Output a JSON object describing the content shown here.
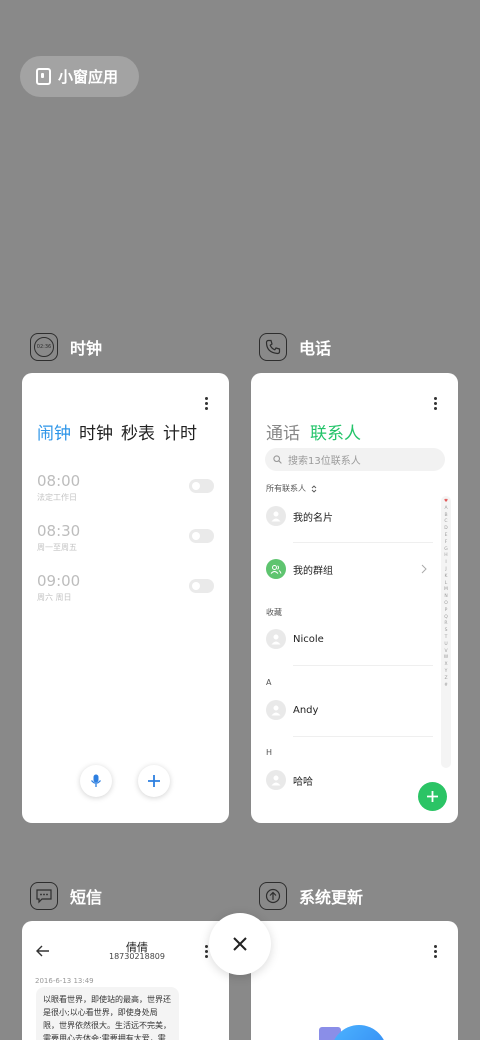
{
  "floating_window": {
    "label": "小窗应用"
  },
  "apps": {
    "clock": {
      "name": "时钟",
      "icon_time": "02:36",
      "tabs": [
        "闹钟",
        "时钟",
        "秒表",
        "计时"
      ],
      "active_tab": "闹钟",
      "alarms": [
        {
          "time": "08:00",
          "repeat": "法定工作日",
          "enabled": false
        },
        {
          "time": "08:30",
          "repeat": "周一至周五",
          "enabled": false
        },
        {
          "time": "09:00",
          "repeat": "周六 周日",
          "enabled": false
        }
      ]
    },
    "phone": {
      "name": "电话",
      "tabs": [
        "通话",
        "联系人"
      ],
      "active_tab": "联系人",
      "search_placeholder": "搜索13位联系人",
      "filter_label": "所有联系人",
      "my_card": "我的名片",
      "my_groups": "我的群组",
      "sections": [
        {
          "header": "收藏",
          "contact": "Nicole"
        },
        {
          "header": "A",
          "contact": "Andy"
        },
        {
          "header": "H",
          "contact": "哈哈"
        }
      ],
      "index_letters": [
        "♥",
        "A",
        "B",
        "C",
        "D",
        "E",
        "F",
        "G",
        "H",
        "I",
        "J",
        "K",
        "L",
        "M",
        "N",
        "O",
        "P",
        "Q",
        "R",
        "S",
        "T",
        "U",
        "V",
        "W",
        "X",
        "Y",
        "Z",
        "#"
      ]
    },
    "sms": {
      "name": "短信",
      "contact_name": "倩倩",
      "contact_number": "18730218809",
      "timestamp": "2016-6-13 13:49",
      "message": "以眼看世界，即使站的最高，世界还是很小;以心看世界，即使身处局限，世界依然很大。生活远不完美，需要用心去体会;需要拥有大爱，需"
    },
    "system_update": {
      "name": "系统更新"
    }
  },
  "colors": {
    "accent_blue": "#2d95e8",
    "accent_green": "#24c46a",
    "background": "#898989"
  }
}
